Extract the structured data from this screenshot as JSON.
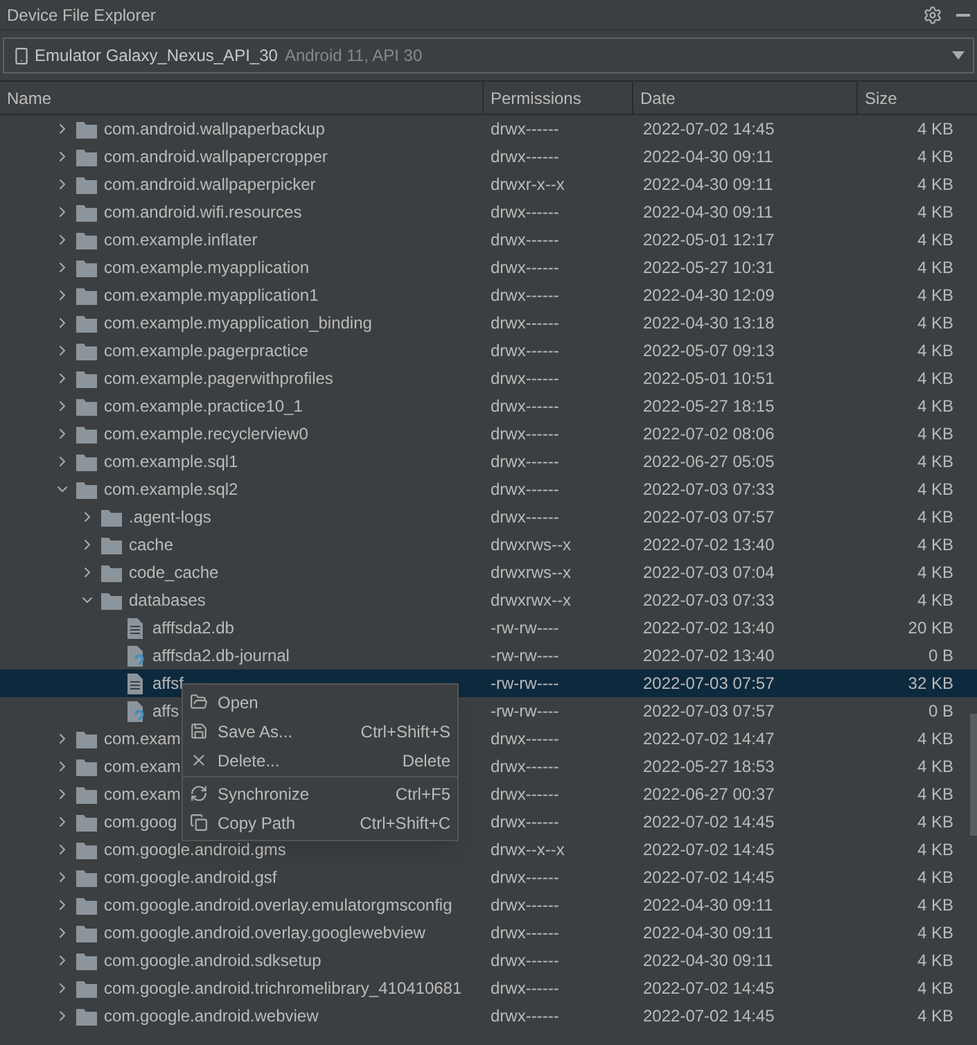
{
  "window": {
    "title": "Device File Explorer"
  },
  "device": {
    "name": "Emulator Galaxy_Nexus_API_30",
    "detail": "Android 11, API 30"
  },
  "table": {
    "columns": [
      "Name",
      "Permissions",
      "Date",
      "Size"
    ],
    "rows": [
      {
        "kind": "folder",
        "name": "com.android.wallpaperbackup",
        "permissions": "drwx------",
        "date": "2022-07-02 14:45",
        "size": "4 KB",
        "expanded": false,
        "selected": false
      },
      {
        "kind": "folder",
        "name": "com.android.wallpapercropper",
        "permissions": "drwx------",
        "date": "2022-04-30 09:11",
        "size": "4 KB",
        "expanded": false,
        "selected": false
      },
      {
        "kind": "folder",
        "name": "com.android.wallpaperpicker",
        "permissions": "drwxr-x--x",
        "date": "2022-04-30 09:11",
        "size": "4 KB",
        "expanded": false,
        "selected": false
      },
      {
        "kind": "folder",
        "name": "com.android.wifi.resources",
        "permissions": "drwx------",
        "date": "2022-04-30 09:11",
        "size": "4 KB",
        "expanded": false,
        "selected": false
      },
      {
        "kind": "folder",
        "name": "com.example.inflater",
        "permissions": "drwx------",
        "date": "2022-05-01 12:17",
        "size": "4 KB",
        "expanded": false,
        "selected": false
      },
      {
        "kind": "folder",
        "name": "com.example.myapplication",
        "permissions": "drwx------",
        "date": "2022-05-27 10:31",
        "size": "4 KB",
        "expanded": false,
        "selected": false
      },
      {
        "kind": "folder",
        "name": "com.example.myapplication1",
        "permissions": "drwx------",
        "date": "2022-04-30 12:09",
        "size": "4 KB",
        "expanded": false,
        "selected": false
      },
      {
        "kind": "folder",
        "name": "com.example.myapplication_binding",
        "permissions": "drwx------",
        "date": "2022-04-30 13:18",
        "size": "4 KB",
        "expanded": false,
        "selected": false
      },
      {
        "kind": "folder",
        "name": "com.example.pagerpractice",
        "permissions": "drwx------",
        "date": "2022-05-07 09:13",
        "size": "4 KB",
        "expanded": false,
        "selected": false
      },
      {
        "kind": "folder",
        "name": "com.example.pagerwithprofiles",
        "permissions": "drwx------",
        "date": "2022-05-01 10:51",
        "size": "4 KB",
        "expanded": false,
        "selected": false
      },
      {
        "kind": "folder",
        "name": "com.example.practice10_1",
        "permissions": "drwx------",
        "date": "2022-05-27 18:15",
        "size": "4 KB",
        "expanded": false,
        "selected": false
      },
      {
        "kind": "folder",
        "name": "com.example.recyclerview0",
        "permissions": "drwx------",
        "date": "2022-07-02 08:06",
        "size": "4 KB",
        "expanded": false,
        "selected": false
      },
      {
        "kind": "folder",
        "name": "com.example.sql1",
        "permissions": "drwx------",
        "date": "2022-06-27 05:05",
        "size": "4 KB",
        "expanded": false,
        "selected": false
      },
      {
        "kind": "folder",
        "name": "com.example.sql2",
        "permissions": "drwx------",
        "date": "2022-07-03 07:33",
        "size": "4 KB",
        "expanded": true,
        "selected": false,
        "children": [
          {
            "kind": "folder",
            "name": ".agent-logs",
            "permissions": "drwx------",
            "date": "2022-07-03 07:57",
            "size": "4 KB",
            "expanded": false,
            "selected": false
          },
          {
            "kind": "folder",
            "name": "cache",
            "permissions": "drwxrws--x",
            "date": "2022-07-02 13:40",
            "size": "4 KB",
            "expanded": false,
            "selected": false
          },
          {
            "kind": "folder",
            "name": "code_cache",
            "permissions": "drwxrws--x",
            "date": "2022-07-03 07:04",
            "size": "4 KB",
            "expanded": false,
            "selected": false
          },
          {
            "kind": "folder",
            "name": "databases",
            "permissions": "drwxrwx--x",
            "date": "2022-07-03 07:33",
            "size": "4 KB",
            "expanded": true,
            "selected": false,
            "children": [
              {
                "kind": "file",
                "name": "afffsda2.db",
                "permissions": "-rw-rw----",
                "date": "2022-07-02 13:40",
                "size": "20 KB",
                "selected": false
              },
              {
                "kind": "unknown-file",
                "name": "afffsda2.db-journal",
                "permissions": "-rw-rw----",
                "date": "2022-07-02 13:40",
                "size": "0 B",
                "selected": false
              },
              {
                "kind": "file",
                "name": "affsf",
                "permissions": "-rw-rw----",
                "date": "2022-07-03 07:57",
                "size": "32 KB",
                "selected": true
              },
              {
                "kind": "unknown-file",
                "name": "affs",
                "permissions": "-rw-rw----",
                "date": "2022-07-03 07:57",
                "size": "0 B",
                "selected": false
              }
            ]
          }
        ]
      },
      {
        "kind": "folder",
        "name": "com.exam",
        "permissions": "drwx------",
        "date": "2022-07-02 14:47",
        "size": "4 KB",
        "expanded": false,
        "selected": false
      },
      {
        "kind": "folder",
        "name": "com.exam",
        "permissions": "drwx------",
        "date": "2022-05-27 18:53",
        "size": "4 KB",
        "expanded": false,
        "selected": false
      },
      {
        "kind": "folder",
        "name": "com.exam",
        "permissions": "drwx------",
        "date": "2022-06-27 00:37",
        "size": "4 KB",
        "expanded": false,
        "selected": false
      },
      {
        "kind": "folder",
        "name": "com.goog",
        "permissions": "drwx------",
        "date": "2022-07-02 14:45",
        "size": "4 KB",
        "expanded": false,
        "selected": false
      },
      {
        "kind": "folder",
        "name": "com.google.android.gms",
        "permissions": "drwx--x--x",
        "date": "2022-07-02 14:45",
        "size": "4 KB",
        "expanded": false,
        "selected": false
      },
      {
        "kind": "folder",
        "name": "com.google.android.gsf",
        "permissions": "drwx------",
        "date": "2022-07-02 14:45",
        "size": "4 KB",
        "expanded": false,
        "selected": false
      },
      {
        "kind": "folder",
        "name": "com.google.android.overlay.emulatorgmsconfig",
        "permissions": "drwx------",
        "date": "2022-04-30 09:11",
        "size": "4 KB",
        "expanded": false,
        "selected": false
      },
      {
        "kind": "folder",
        "name": "com.google.android.overlay.googlewebview",
        "permissions": "drwx------",
        "date": "2022-04-30 09:11",
        "size": "4 KB",
        "expanded": false,
        "selected": false
      },
      {
        "kind": "folder",
        "name": "com.google.android.sdksetup",
        "permissions": "drwx------",
        "date": "2022-04-30 09:11",
        "size": "4 KB",
        "expanded": false,
        "selected": false
      },
      {
        "kind": "folder",
        "name": "com.google.android.trichromelibrary_410410681",
        "permissions": "drwx------",
        "date": "2022-07-02 14:45",
        "size": "4 KB",
        "expanded": false,
        "selected": false
      },
      {
        "kind": "folder",
        "name": "com.google.android.webview",
        "permissions": "drwx------",
        "date": "2022-07-02 14:45",
        "size": "4 KB",
        "expanded": false,
        "selected": false
      }
    ]
  },
  "context_menu": {
    "items": [
      {
        "kind": "open",
        "label": "Open"
      },
      {
        "kind": "save",
        "label": "Save As...",
        "shortcut": "Ctrl+Shift+S"
      },
      {
        "kind": "delete",
        "label": "Delete...",
        "shortcut": "Delete"
      },
      {
        "kind": "sync",
        "label": "Synchronize",
        "shortcut": "Ctrl+F5"
      },
      {
        "kind": "copy",
        "label": "Copy Path",
        "shortcut": "Ctrl+Shift+C"
      }
    ]
  }
}
